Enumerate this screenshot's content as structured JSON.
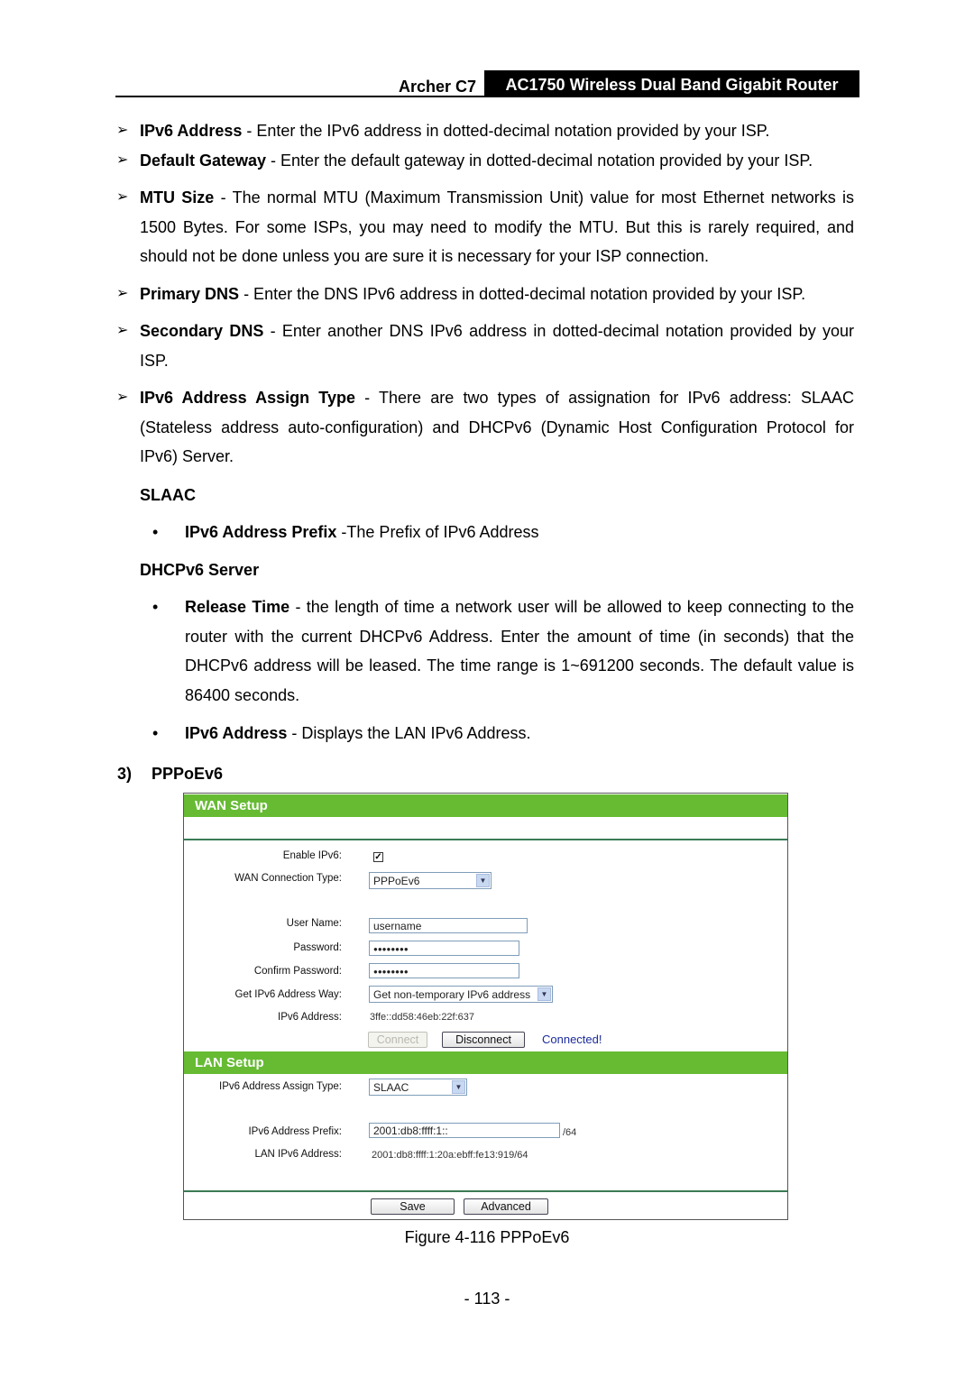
{
  "header": {
    "model": "Archer C7",
    "product": "AC1750 Wireless Dual Band Gigabit Router"
  },
  "items": [
    {
      "term": "IPv6 Address",
      "text": " - Enter the IPv6 address in dotted-decimal notation provided by your ISP."
    },
    {
      "term": "Default Gateway",
      "text": " - Enter the default gateway in dotted-decimal notation provided by your ISP."
    },
    {
      "term": "MTU Size",
      "text": " - The normal MTU (Maximum Transmission Unit) value for most Ethernet networks is 1500 Bytes. For some ISPs, you may need to modify the MTU. But this is rarely required, and should not be done unless you are sure it is necessary for your ISP connection."
    },
    {
      "term": "Primary DNS",
      "text": " - Enter the DNS IPv6 address in dotted-decimal notation provided by your ISP."
    },
    {
      "term": "Secondary DNS",
      "text": " - Enter another DNS IPv6 address in dotted-decimal notation provided by your ISP."
    },
    {
      "term": "IPv6 Address Assign Type",
      "text": " - There are two types of assignation for IPv6 address: SLAAC (Stateless address auto-configuration) and DHCPv6 (Dynamic Host Configuration Protocol for IPv6) Server."
    }
  ],
  "slaac": {
    "heading": "SLAAC",
    "bullets": [
      {
        "term": "IPv6 Address Prefix",
        "text": " -The Prefix of IPv6 Address"
      }
    ]
  },
  "dhcpv6": {
    "heading": "DHCPv6 Server",
    "bullets": [
      {
        "term": "Release Time",
        "text": " - the length of time a network user will be allowed to keep connecting to the router with the current DHCPv6 Address. Enter the amount of time (in seconds) that the DHCPv6 address will be leased. The time range is 1~691200 seconds. The default value is 86400 seconds."
      },
      {
        "term": "IPv6 Address",
        "text": " - Displays the LAN IPv6 Address."
      }
    ]
  },
  "section3": {
    "number": "3)",
    "title": "PPPoEv6"
  },
  "figure": {
    "wan": {
      "title": "WAN Setup",
      "enable_ipv6_label": "Enable IPv6:",
      "enable_ipv6_checked": true,
      "check_glyph": "✓",
      "conn_type_label": "WAN Connection Type:",
      "conn_type_value": "PPPoEv6",
      "username_label": "User Name:",
      "username_value": "username",
      "password_label": "Password:",
      "password_value": "●●●●●●●●",
      "confirm_label": "Confirm Password:",
      "confirm_value": "●●●●●●●●",
      "addr_way_label": "Get IPv6 Address Way:",
      "addr_way_value": "Get non-temporary IPv6 address",
      "ipv6_addr_label": "IPv6 Address:",
      "ipv6_addr_value": "3ffe::dd58:46eb:22f:637",
      "connect_label": "Connect",
      "disconnect_label": "Disconnect",
      "status": "Connected!"
    },
    "lan": {
      "title": "LAN Setup",
      "assign_type_label": "IPv6 Address Assign Type:",
      "assign_type_value": "SLAAC",
      "prefix_label": "IPv6 Address Prefix:",
      "prefix_value": "2001:db8:ffff:1::",
      "prefix_suffix": "/64",
      "lan_addr_label": "LAN IPv6 Address:",
      "lan_addr_value": "2001:db8:ffff:1:20a:ebff:fe13:919/64"
    },
    "save_label": "Save",
    "advanced_label": "Advanced",
    "dropdown_glyph": "▼",
    "caption": "Figure 4-116 PPPoEv6"
  },
  "page_number": "- 113 -",
  "arrow_glyph": "➢",
  "bullet_glyph": "•"
}
